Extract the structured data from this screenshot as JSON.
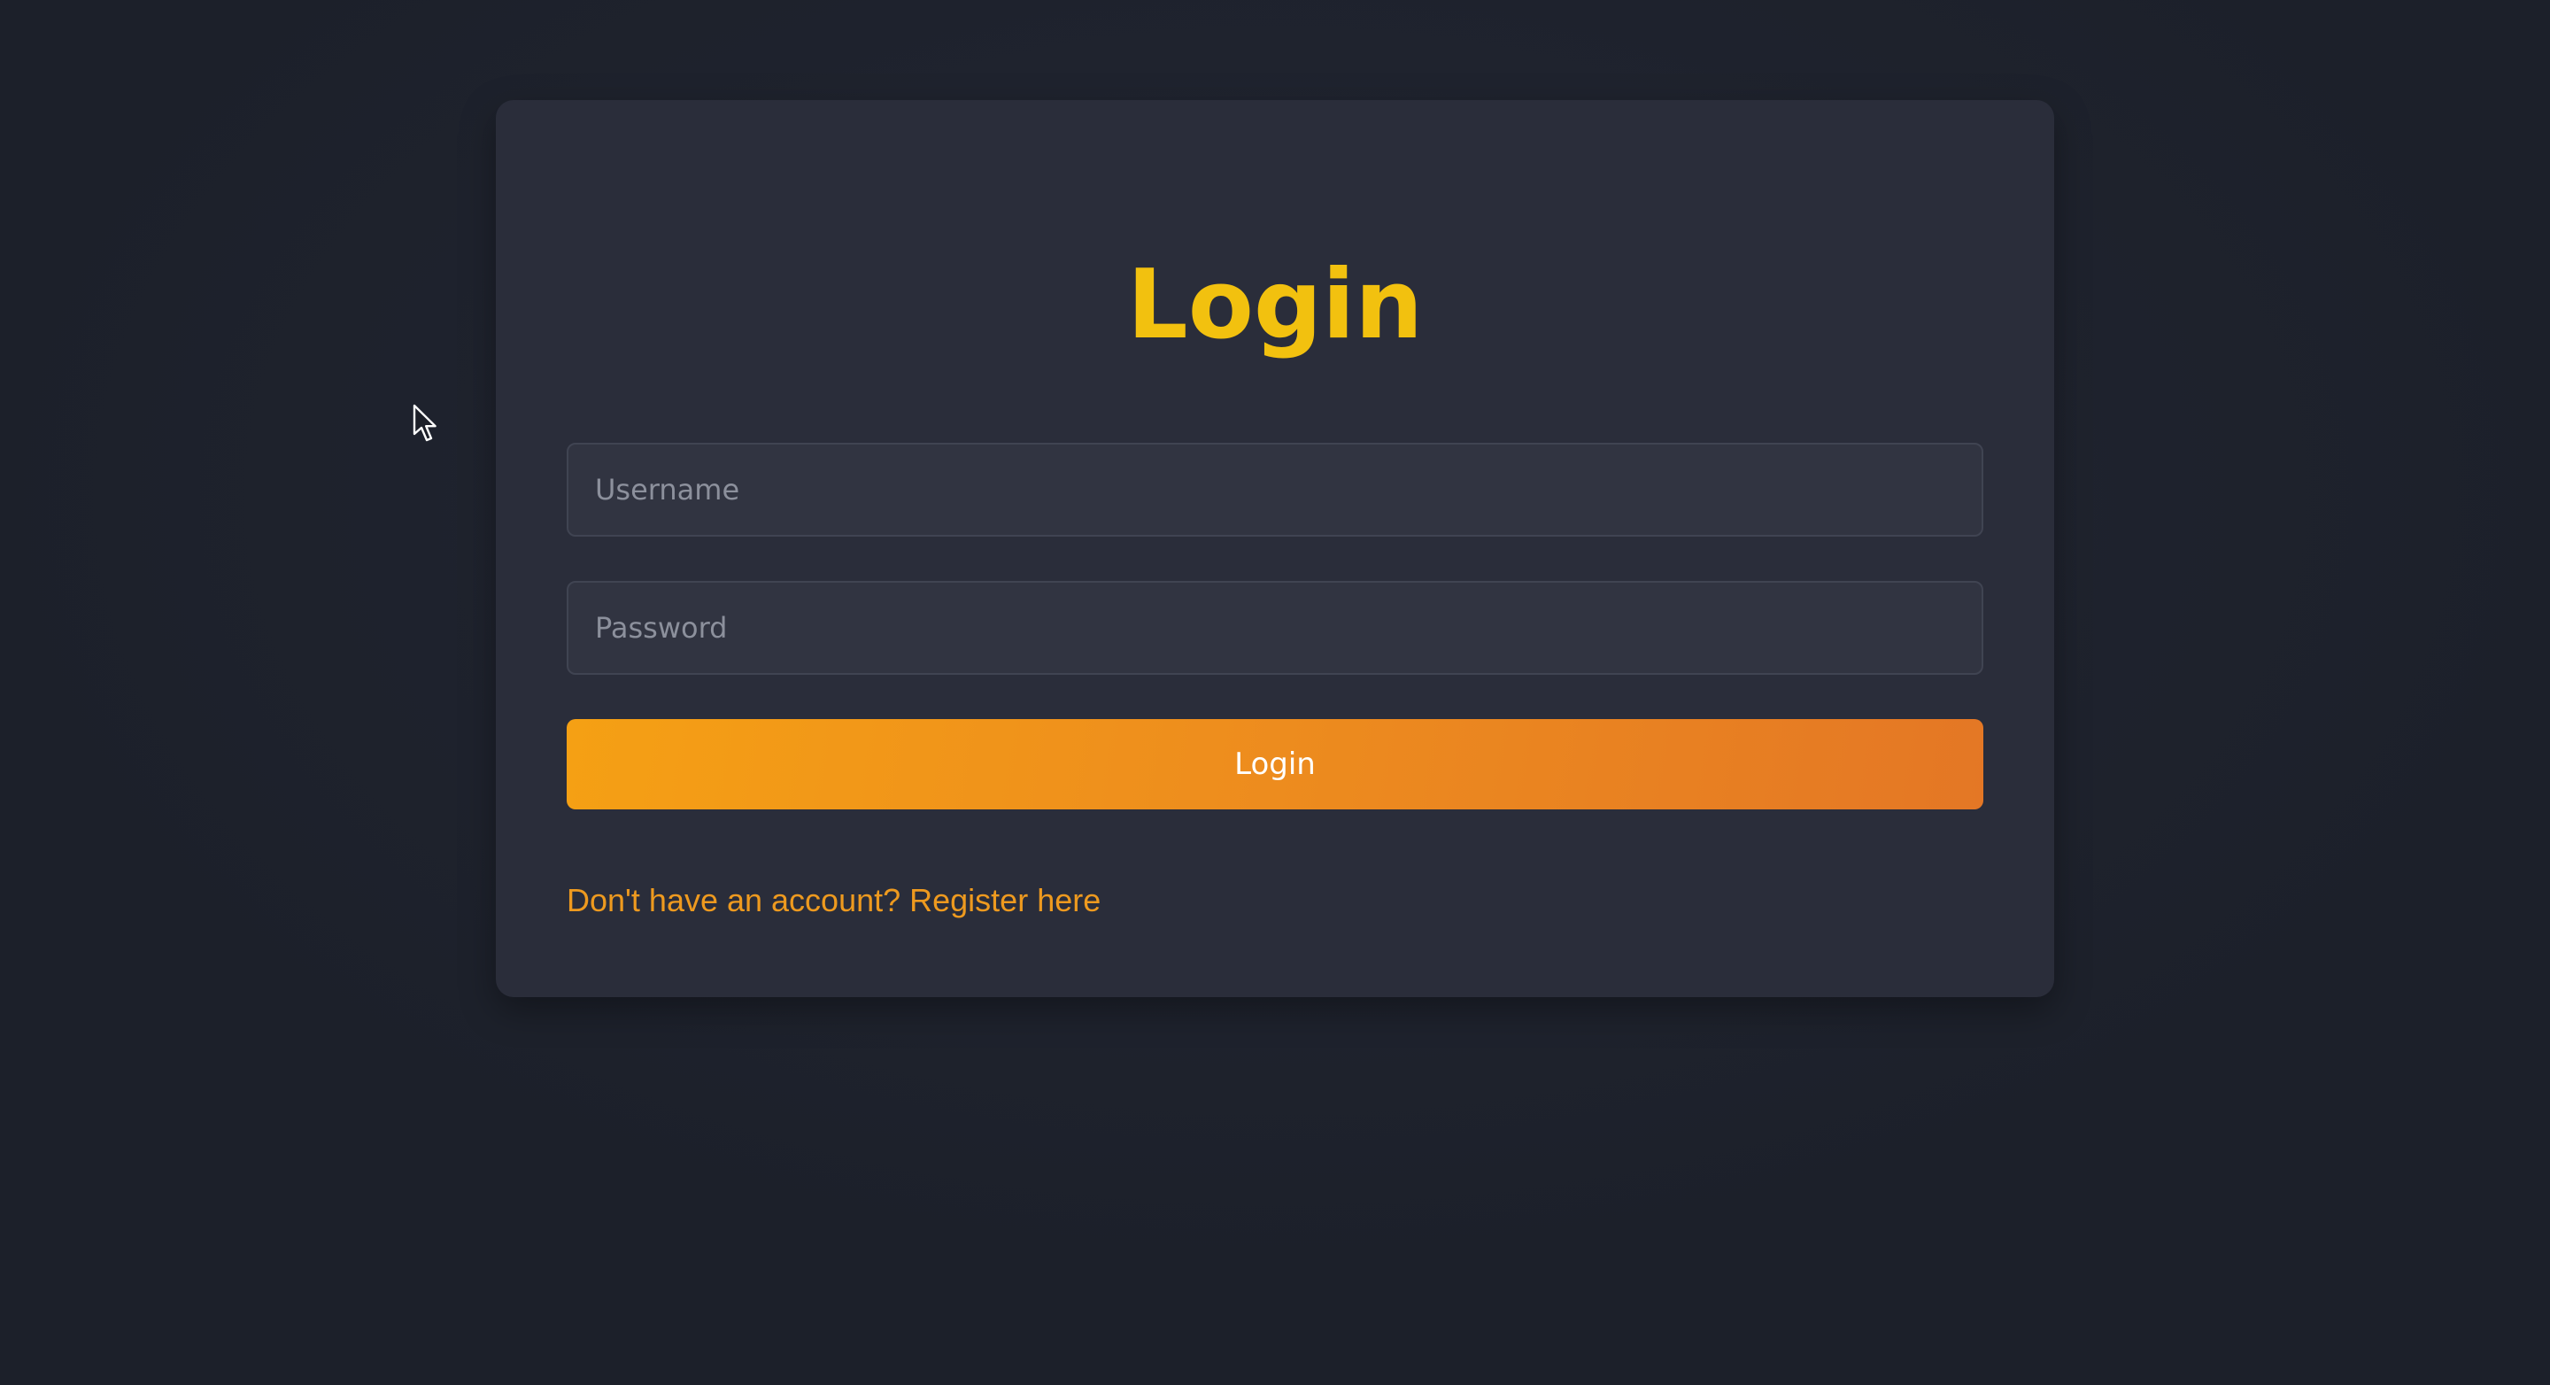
{
  "login_form": {
    "title": "Login",
    "username_placeholder": "Username",
    "password_placeholder": "Password",
    "submit_label": "Login",
    "register_link_text": "Don't have an account? Register here"
  },
  "colors": {
    "background": "#1f232e",
    "card": "#2a2d3a",
    "title": "#f2c10f",
    "button_gradient_start": "#f5a014",
    "button_gradient_end": "#e47725",
    "link": "#ee9a1f"
  },
  "icons": {
    "cursor": "mouse-pointer-icon"
  }
}
